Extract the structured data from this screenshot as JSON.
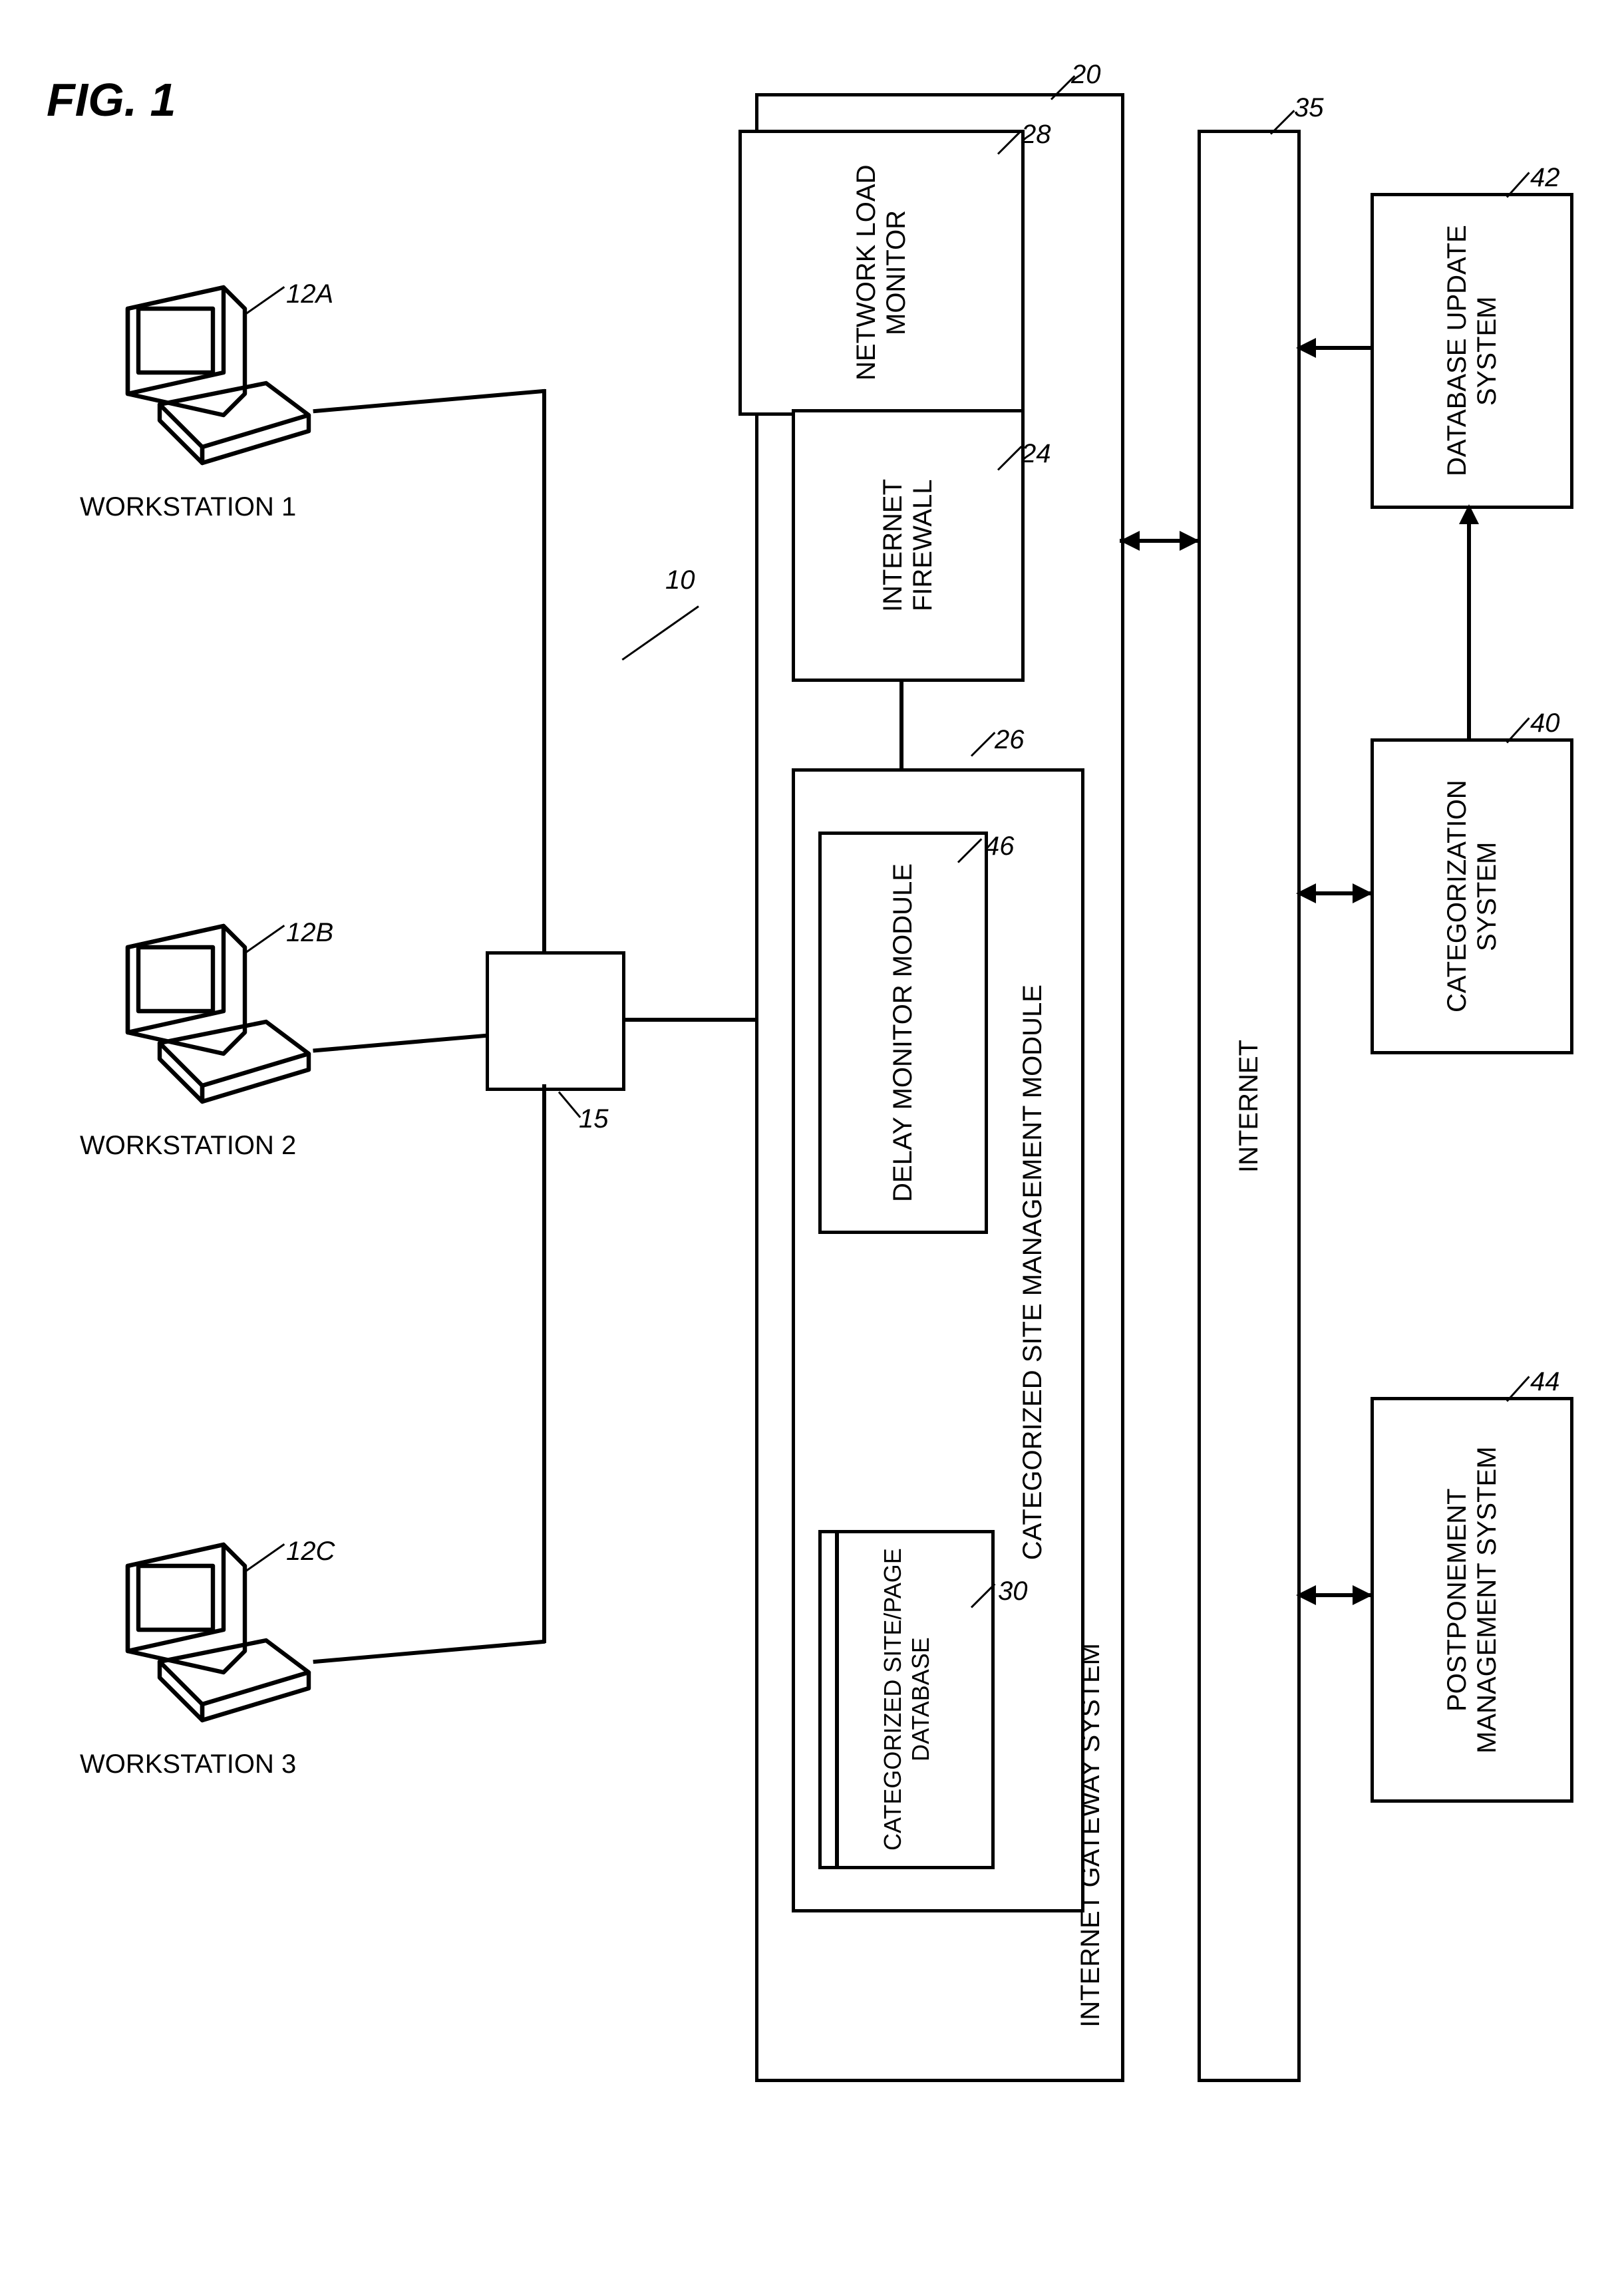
{
  "figure_label": "FIG. 1",
  "system_number": "10",
  "workstations": [
    {
      "label": "WORKSTATION 1",
      "ref": "12A"
    },
    {
      "label": "WORKSTATION 2",
      "ref": "12B"
    },
    {
      "label": "WORKSTATION 3",
      "ref": "12C"
    }
  ],
  "hub_ref": "15",
  "gateway": {
    "label": "INTERNET GATEWAY SYSTEM",
    "ref": "20",
    "nlm": {
      "label": "NETWORK LOAD MONITOR",
      "ref": "28"
    },
    "firewall": {
      "label": "INTERNET FIREWALL",
      "ref": "24"
    },
    "csmm": {
      "label": "CATEGORIZED SITE MANAGEMENT MODULE",
      "ref": "26"
    },
    "dmm": {
      "label": "DELAY MONITOR MODULE",
      "ref": "46"
    },
    "db": {
      "label": "CATEGORIZED SITE/PAGE DATABASE",
      "ref": "30"
    }
  },
  "internet": {
    "label": "INTERNET",
    "ref": "35"
  },
  "dbupdate": {
    "label": "DATABASE UPDATE SYSTEM",
    "ref": "42"
  },
  "catsys": {
    "label": "CATEGORIZATION SYSTEM",
    "ref": "40"
  },
  "pms": {
    "label": "POSTPONEMENT MANAGEMENT SYSTEM",
    "ref": "44"
  }
}
